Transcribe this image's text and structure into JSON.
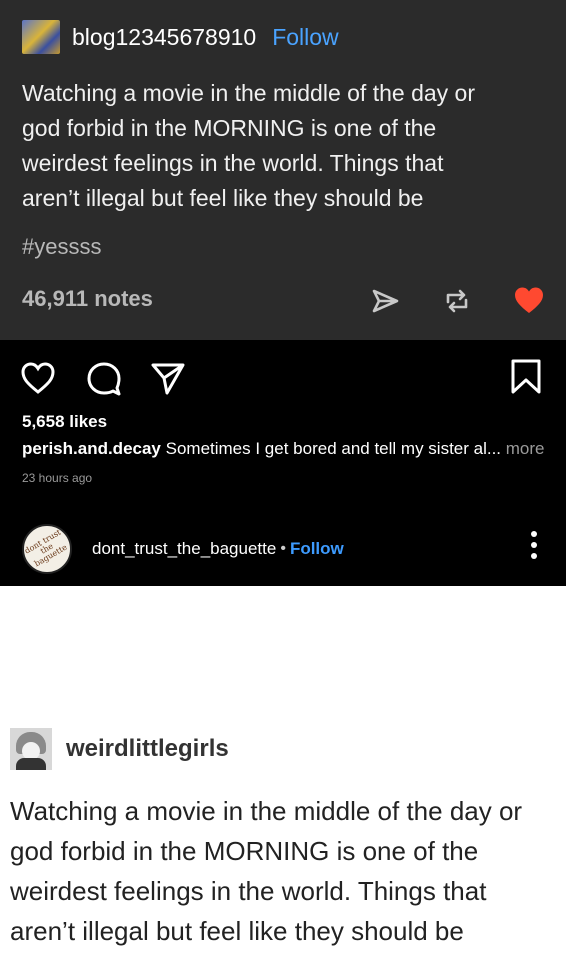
{
  "tumblr_top": {
    "username": "blog12345678910",
    "follow_label": "Follow",
    "body_lines": [
      "Watching a movie in the middle of the day or",
      "god forbid in the MORNING is one of the",
      "weirdest feelings in the world. Things that",
      "aren’t illegal but feel like they should be"
    ],
    "tag": "#yessss",
    "notes": "46,911 notes",
    "colors": {
      "background": "#2b2b2b",
      "follow": "#4aa3ff",
      "heart": "#ff4930"
    },
    "icons": [
      "share-icon",
      "reblog-icon",
      "heart-icon"
    ]
  },
  "instagram": {
    "likes": "5,658 likes",
    "caption_user": "perish.and.decay",
    "caption_text": " Sometimes I get bored and tell my sister al...",
    "more_label": " more",
    "time": "23 hours ago",
    "avatar_text": "dont trust the baguette",
    "handle": "dont_trust_the_baguette",
    "dot": "•",
    "follow_label": "Follow",
    "colors": {
      "follow": "#3d9bff"
    },
    "icons": [
      "heart-outline-icon",
      "comment-icon",
      "send-icon",
      "bookmark-icon",
      "more-vertical-icon"
    ]
  },
  "tumblr_bottom": {
    "username": "weirdlittlegirls",
    "body_lines": [
      "Watching a movie in the middle of the day or",
      "god forbid in the MORNING is one of the",
      "weirdest feelings in the world. Things that",
      "aren’t illegal but feel like they should be"
    ]
  }
}
